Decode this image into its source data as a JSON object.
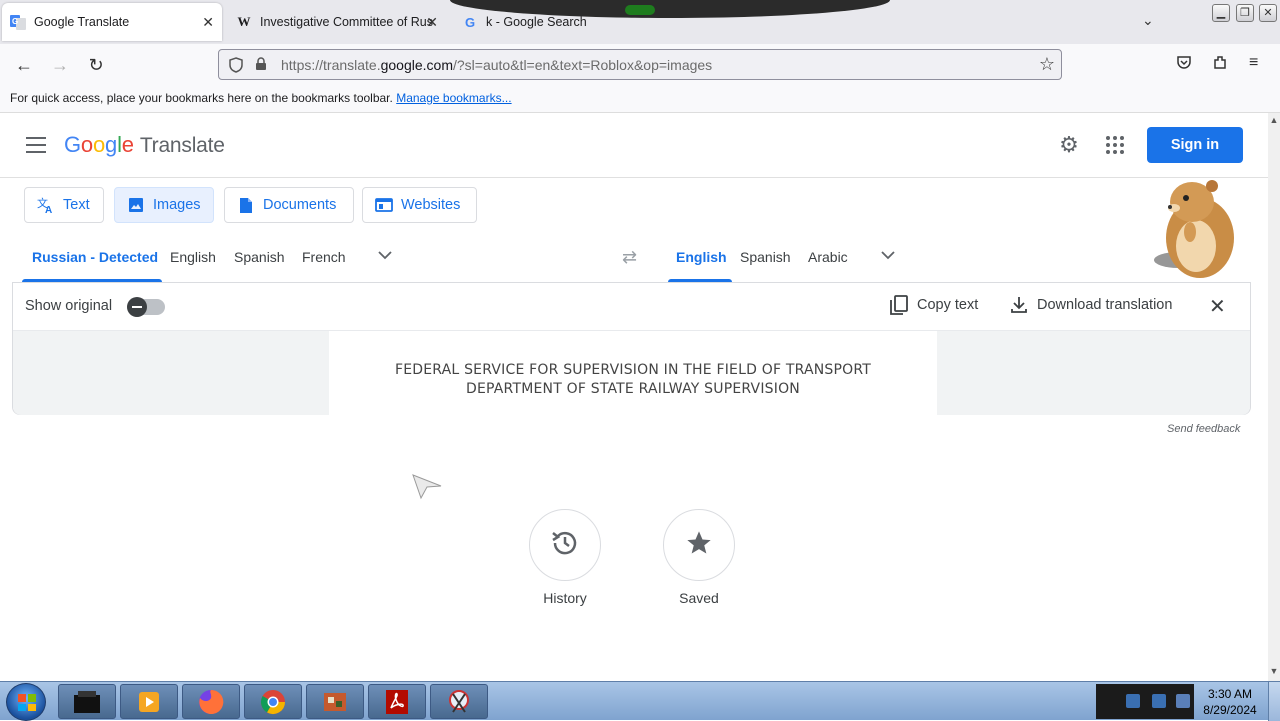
{
  "browser": {
    "tabs": [
      {
        "favicon": "google-translate-favicon",
        "title": "Google Translate",
        "active": true
      },
      {
        "favicon": "wikipedia-favicon",
        "title": "Investigative Committee of Rus",
        "active": false
      },
      {
        "favicon": "google-favicon",
        "title": "k - Google Search",
        "active": false
      }
    ],
    "url_prefix": "https://translate.",
    "url_domain": "google.com",
    "url_rest": "/?sl=auto&tl=en&text=Roblox&op=images",
    "bookmarks_text": "For quick access, place your bookmarks here on the bookmarks toolbar.",
    "bookmarks_link": "Manage bookmarks..."
  },
  "header": {
    "logo_word": [
      "G",
      "o",
      "o",
      "g",
      "l",
      "e"
    ],
    "product": "Translate",
    "signin_label": "Sign in"
  },
  "modes": [
    {
      "icon": "translate-icon",
      "label": "Text"
    },
    {
      "icon": "image-icon",
      "label": "Images",
      "selected": true
    },
    {
      "icon": "document-icon",
      "label": "Documents"
    },
    {
      "icon": "website-icon",
      "label": "Websites"
    }
  ],
  "source_langs": [
    "Russian - Detected",
    "English",
    "Spanish",
    "French"
  ],
  "target_langs": [
    "English",
    "Spanish",
    "Arabic"
  ],
  "panel": {
    "show_original": "Show original",
    "copy_text": "Copy text",
    "download_translation": "Download translation",
    "doc_line1": "FEDERAL SERVICE FOR SUPERVISION IN THE FIELD OF TRANSPORT",
    "doc_line2": "DEPARTMENT OF STATE RAILWAY SUPERVISION"
  },
  "feedback": "Send feedback",
  "history_label": "History",
  "saved_label": "Saved",
  "taskbar": {
    "time": "3:30 AM",
    "date": "8/29/2024"
  },
  "colors": {
    "accent_blue": "#1a73e8",
    "selected_mode_bg": "#e8f0fe"
  }
}
